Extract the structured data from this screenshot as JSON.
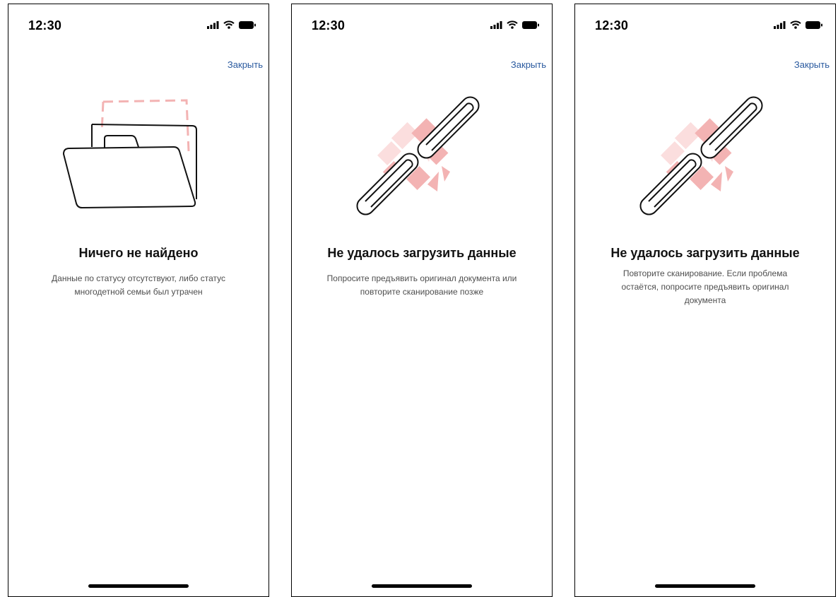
{
  "status_bar": {
    "time": "12:30",
    "icons": [
      "signal-icon",
      "wifi-icon",
      "battery-icon"
    ]
  },
  "colors": {
    "link": "#2a5a9f",
    "illustration_accent": "#f3b3b3",
    "illustration_accent_light": "#fbdede"
  },
  "screens": [
    {
      "close_label": "Закрыть",
      "illustration": "folder-icon",
      "title": "Ничего не найдено",
      "message": "Данные по статусу отсутствуют, либо статус многодетной семьи был утрачен"
    },
    {
      "close_label": "Закрыть",
      "illustration": "broken-link-icon",
      "title": "Не удалось загрузить данные",
      "message": "Попросите предъявить оригинал документа или повторите сканирование позже"
    },
    {
      "close_label": "Закрыть",
      "illustration": "broken-link-icon",
      "title": "Не удалось загрузить данные",
      "message": "Повторите сканирование. Если проблема остаётся, попросите предъявить оригинал документа"
    }
  ]
}
